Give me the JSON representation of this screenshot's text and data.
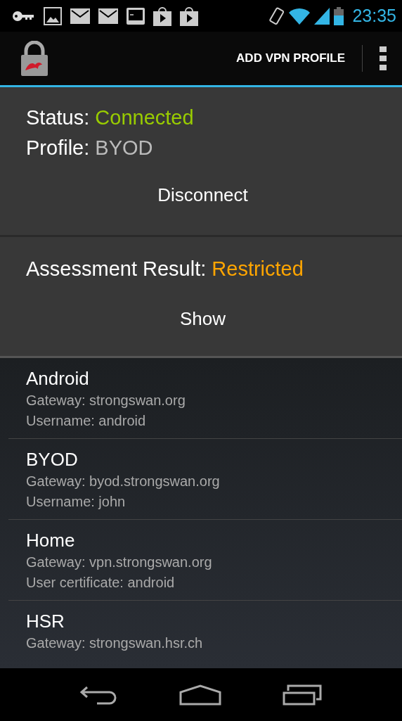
{
  "status_bar": {
    "time": "23:35"
  },
  "action_bar": {
    "action": "ADD VPN PROFILE"
  },
  "connection": {
    "status_label": "Status:",
    "status": "Connected",
    "profile_label": "Profile:",
    "profile": "BYOD",
    "button": "Disconnect"
  },
  "assessment": {
    "label": "Assessment Result:",
    "result": "Restricted",
    "button": "Show"
  },
  "profiles": [
    {
      "name": "Android",
      "details": [
        "Gateway: strongswan.org",
        "Username: android"
      ]
    },
    {
      "name": "BYOD",
      "details": [
        "Gateway: byod.strongswan.org",
        "Username: john"
      ]
    },
    {
      "name": "Home",
      "details": [
        "Gateway: vpn.strongswan.org",
        "User certificate: android"
      ]
    },
    {
      "name": "HSR",
      "details": [
        "Gateway: strongswan.hsr.ch"
      ]
    }
  ]
}
